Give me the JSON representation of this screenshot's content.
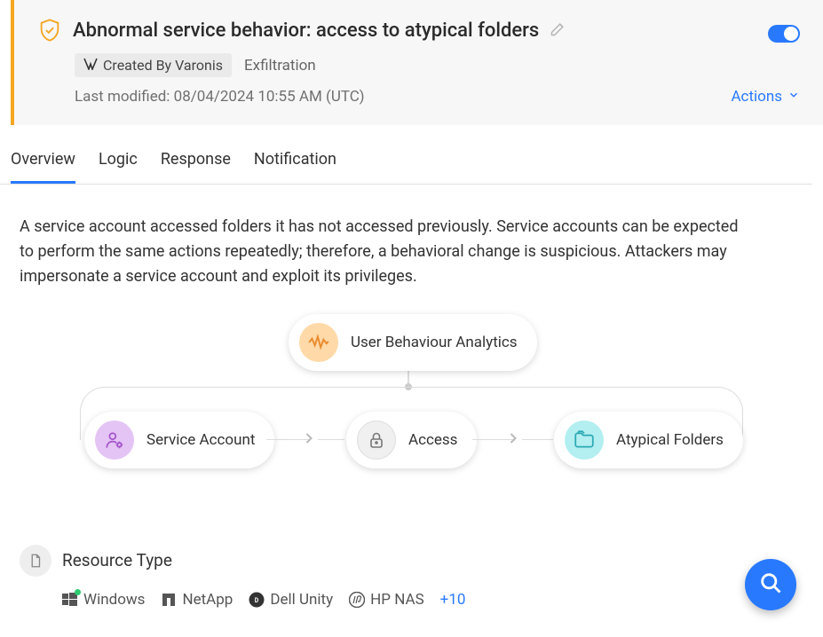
{
  "header": {
    "title": "Abnormal service behavior: access to atypical folders",
    "created_by": "Created By Varonis",
    "category": "Exfiltration",
    "last_modified": "Last modified: 08/04/2024 10:55 AM (UTC)",
    "actions": "Actions",
    "toggle_on": true
  },
  "tabs": [
    "Overview",
    "Logic",
    "Response",
    "Notification"
  ],
  "description": "A service account accessed folders it has not accessed previously. Service accounts can be expected to perform the same actions repeatedly; therefore, a behavioral change is suspicious. Attackers may impersonate a service account and exploit its privileges.",
  "diagram": {
    "top": "User Behaviour Analytics",
    "nodes": [
      "Service Account",
      "Access",
      "Atypical Folders"
    ]
  },
  "resource": {
    "section_title": "Resource Type",
    "items": [
      "Windows",
      "NetApp",
      "Dell Unity",
      "HP NAS"
    ],
    "more": "+10"
  }
}
